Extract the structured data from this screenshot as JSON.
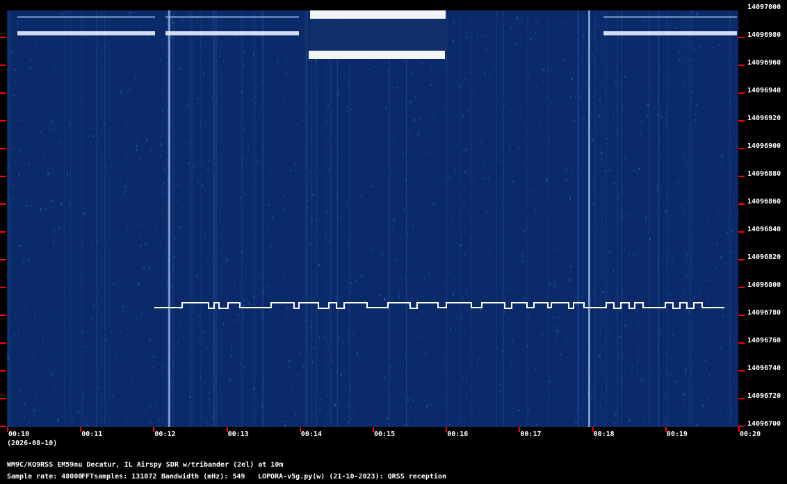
{
  "colors": {
    "background": "#000000",
    "waterfall": "#0a2a6a",
    "tick": "#ff0000",
    "signal": "#ffffff"
  },
  "y_axis": {
    "labels": [
      "14097000",
      "14096980",
      "14096960",
      "14096940",
      "14096920",
      "14096900",
      "14096880",
      "14096860",
      "14096840",
      "14096820",
      "14096800",
      "14096780",
      "14096760",
      "14096740",
      "14096720",
      "14096700"
    ]
  },
  "x_axis": {
    "labels": [
      "00:10",
      "00:11",
      "00:12",
      "00:13",
      "00:14",
      "00:15",
      "00:16",
      "00:17",
      "00:18",
      "00:19",
      "00:20"
    ]
  },
  "date": "(2026-08-10)",
  "footer": {
    "station": "WM9C/KQ9RSS EM59nu Decatur, IL  Airspy SDR w/tribander (2el) at 10m",
    "sample_rate": "Sample rate: 48000",
    "fft": "FFTsamples: 131072",
    "bandwidth": "Bandwidth (mHz): 549",
    "software": "LOPORA-v5g.py(w) (21-10-2023): QRSS reception"
  }
}
